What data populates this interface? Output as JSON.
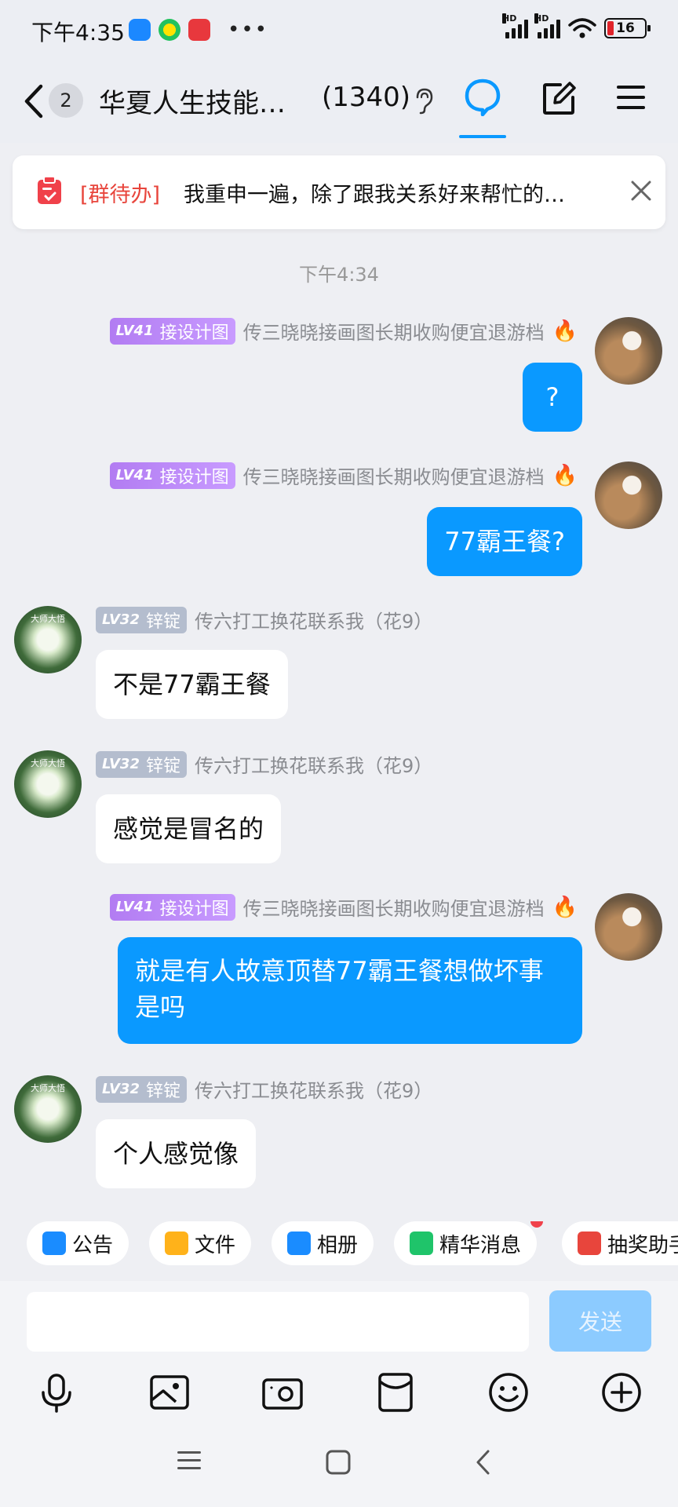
{
  "status_bar": {
    "time": "下午4:35",
    "battery": "16",
    "more": "•••"
  },
  "header": {
    "unread_count": "2",
    "group_name": "华夏人生技能…",
    "member_count": "(1340)"
  },
  "todo": {
    "tag": "[群待办]",
    "text": "我重申一遍，除了跟我关系好来帮忙的…"
  },
  "chat": {
    "timestamp": "下午4:34",
    "messages": [
      {
        "side": "self",
        "level": "LV41",
        "title": "接设计图",
        "nickname": "传三晓晓接画图长期收购便宜退游档",
        "text": "?"
      },
      {
        "side": "self",
        "level": "LV41",
        "title": "接设计图",
        "nickname": "传三晓晓接画图长期收购便宜退游档",
        "text": "77霸王餐?"
      },
      {
        "side": "other",
        "level": "LV32",
        "title": "锌锭",
        "nickname": "传六打工换花联系我（花9）",
        "text": "不是77霸王餐"
      },
      {
        "side": "other",
        "level": "LV32",
        "title": "锌锭",
        "nickname": "传六打工换花联系我（花9）",
        "text": "感觉是冒名的"
      },
      {
        "side": "self",
        "level": "LV41",
        "title": "接设计图",
        "nickname": "传三晓晓接画图长期收购便宜退游档",
        "text": "就是有人故意顶替77霸王餐想做坏事是吗"
      },
      {
        "side": "other",
        "level": "LV32",
        "title": "锌锭",
        "nickname": "传六打工换花联系我（花9）",
        "text": "个人感觉像"
      }
    ],
    "lotus_avatar_text": "大师大悟"
  },
  "quick_tools": [
    {
      "label": "公告",
      "icon": "announcement-icon",
      "color": "#1a8cff"
    },
    {
      "label": "文件",
      "icon": "folder-icon",
      "color": "#ffb21a"
    },
    {
      "label": "相册",
      "icon": "album-icon",
      "color": "#1a8cff"
    },
    {
      "label": "精华消息",
      "icon": "essence-icon",
      "color": "#1fc46a"
    },
    {
      "label": "抽奖助手",
      "icon": "gift-icon",
      "color": "#e8453c"
    }
  ],
  "input": {
    "placeholder": "",
    "send_label": "发送"
  },
  "toolbar": [
    "microphone-icon",
    "image-icon",
    "camera-icon",
    "red-packet-icon",
    "emoji-icon",
    "plus-icon"
  ],
  "colors": {
    "accent": "#0a99ff",
    "background": "#eeeff3",
    "send_disabled": "#8ccbff"
  }
}
